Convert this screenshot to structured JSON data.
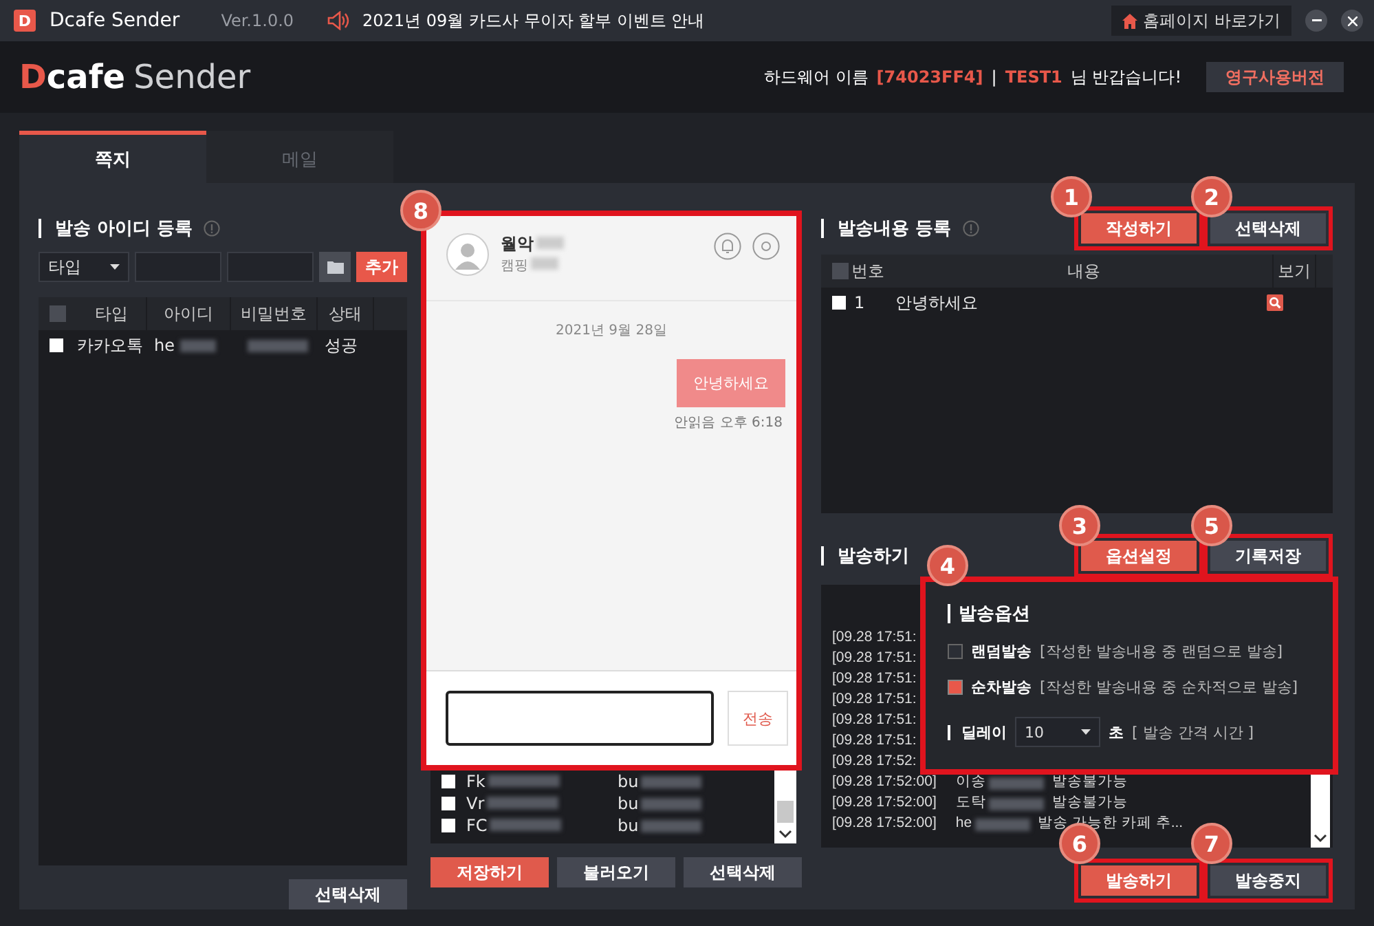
{
  "title_bar": {
    "app_icon_letter": "D",
    "app_name": "Dcafe Sender",
    "version": "Ver.1.0.0",
    "notice": "2021년 09월 카드사 무이자 할부 이벤트 안내",
    "home_button": "홈페이지 바로가기"
  },
  "header": {
    "logo_mark": "D",
    "logo_rest": "cafe",
    "logo_second": "Sender",
    "hardware_label": "하드웨어 이름",
    "hardware_id": "[74023FF4]",
    "separator": "|",
    "user": "TEST1",
    "greeting": "님 반갑습니다!",
    "upgrade_button": "영구사용버전"
  },
  "tabs": [
    {
      "label": "쪽지",
      "selected": true
    },
    {
      "label": "메일",
      "selected": false
    }
  ],
  "accounts": {
    "title": "발송 아이디 등록",
    "type_select": "타입",
    "add_button": "추가",
    "columns": [
      "타입",
      "아이디",
      "비밀번호",
      "상태"
    ],
    "header_checked": false,
    "rows": [
      {
        "checked": false,
        "type": "카카오톡",
        "id": "he",
        "status": "성공"
      }
    ],
    "delete_button": "선택삭제"
  },
  "chat": {
    "name": "월악",
    "subtitle": "캠핑",
    "date": "2021년 9월 28일",
    "message": "안녕하세요",
    "read_time": "안읽음 오후 6:18",
    "send_button": "전송"
  },
  "saved_list": {
    "rows": [
      {
        "checked": false,
        "id": "Fk",
        "password": "bu"
      },
      {
        "checked": false,
        "id": "Vr",
        "password": "bu"
      },
      {
        "checked": false,
        "id": "FC",
        "password": "bu"
      }
    ],
    "buttons": [
      {
        "label": "저장하기",
        "kind": "primary"
      },
      {
        "label": "불러오기",
        "kind": "secondary"
      },
      {
        "label": "선택삭제",
        "kind": "secondary"
      }
    ]
  },
  "contents": {
    "title": "발송내용 등록",
    "buttons": [
      {
        "label": "작성하기",
        "kind": "primary",
        "framed": true
      },
      {
        "label": "선택삭제",
        "kind": "secondary",
        "framed": true
      }
    ],
    "columns": [
      "번호",
      "내용",
      "보기"
    ],
    "header_checked": false,
    "rows": [
      {
        "checked": false,
        "number": "1",
        "content": "안녕하세요"
      }
    ]
  },
  "sending": {
    "title": "발송하기",
    "buttons": [
      {
        "label": "옵션설정",
        "kind": "primary",
        "framed": true
      },
      {
        "label": "기록저장",
        "kind": "secondary",
        "framed": true
      }
    ],
    "log": [
      {
        "time": "[09.28 17:51:"
      },
      {
        "time": "[09.28 17:51:"
      },
      {
        "time": "[09.28 17:51:"
      },
      {
        "time": "[09.28 17:51:"
      },
      {
        "time": "[09.28 17:51:"
      },
      {
        "time": "[09.28 17:51:"
      },
      {
        "time": "[09.28 17:52:"
      },
      {
        "time": "[09.28 17:52:00]",
        "name": "이송",
        "message": "발송불가능"
      },
      {
        "time": "[09.28 17:52:00]",
        "name": "도탁",
        "message": "발송불가능"
      },
      {
        "time": "[09.28 17:52:00]",
        "name": "he",
        "message": "발송 가능한 카페 추..."
      }
    ],
    "options": {
      "title": "발송옵션",
      "items": [
        {
          "label": "랜덤발송",
          "hint": "[작성한 발송내용 중 랜덤으로 발송]",
          "checked": false
        },
        {
          "label": "순차발송",
          "hint": "[작성한 발송내용 중 순차적으로 발송]",
          "checked": true
        }
      ],
      "delay_label": "딜레이",
      "delay_value": "10",
      "delay_unit": "초",
      "delay_hint": "[ 발송 간격 시간 ]"
    },
    "bottom_buttons": [
      {
        "label": "발송하기",
        "kind": "primary",
        "framed": true
      },
      {
        "label": "발송중지",
        "kind": "secondary",
        "framed": true
      }
    ]
  },
  "callouts": [
    "1",
    "2",
    "3",
    "4",
    "5",
    "6",
    "7",
    "8"
  ]
}
